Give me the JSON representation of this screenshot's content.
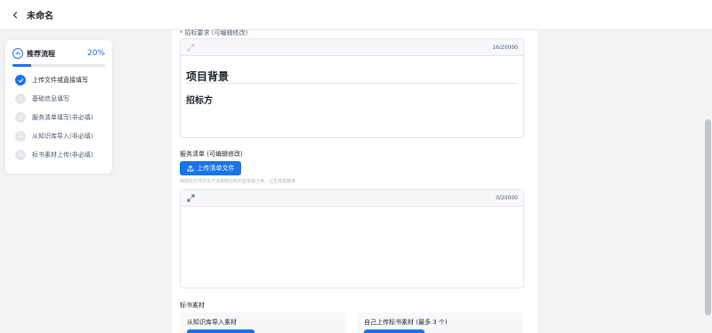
{
  "header": {
    "title": "未命名"
  },
  "steps": {
    "title": "推荐流程",
    "percent_text": "20%",
    "progress": 0.2,
    "items": [
      {
        "number": "1",
        "label": "上传文件或直接填写",
        "done": true
      },
      {
        "number": "2",
        "label": "基础信息填写",
        "done": false
      },
      {
        "number": "3",
        "label": "服务清单填写(非必填)",
        "done": false
      },
      {
        "number": "4",
        "label": "从知识库导入(非必填)",
        "done": false
      },
      {
        "number": "5",
        "label": "标书素材上传(非必填)",
        "done": false
      }
    ]
  },
  "requirements": {
    "label": "招标要求 (可编辑修改)",
    "count": "16/20000",
    "heading1": "项目背景",
    "heading2": "招标方"
  },
  "service_list": {
    "label": "服务清单 (可编辑修改)",
    "upload_label": "上传清单文件",
    "hint": "将招标文件中关于清单部分的内容单独上传，让生成更精准",
    "count": "0/20000"
  },
  "materials": {
    "label": "标书素材",
    "kb_title": "从知识库导入素材",
    "self_title": "自己上传标书素材 (最多 3 个)"
  },
  "colors": {
    "accent": "#1a73e8",
    "required": "#f53f3f"
  }
}
